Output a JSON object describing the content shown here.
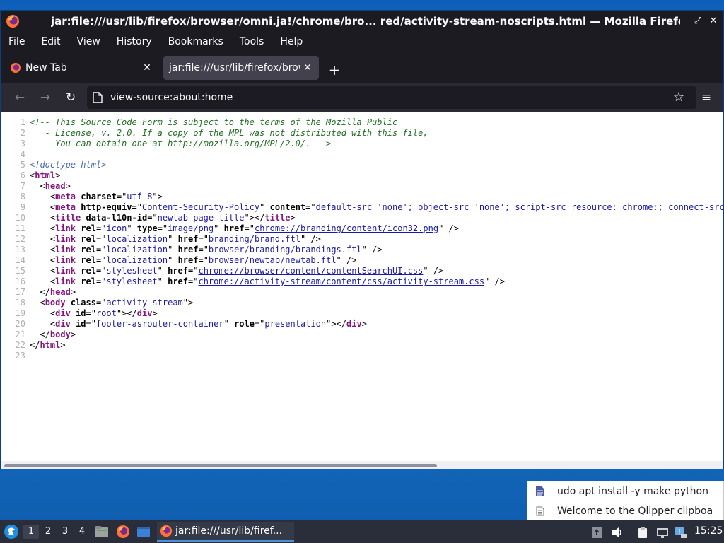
{
  "window": {
    "title": "jar:file:///usr/lib/firefox/browser/omni.ja!/chrome/bro... red/activity-stream-noscripts.html — Mozilla Firefox",
    "controls": [
      "–",
      "⤢",
      "✕"
    ]
  },
  "menu": [
    "File",
    "Edit",
    "View",
    "History",
    "Bookmarks",
    "Tools",
    "Help"
  ],
  "tabs": [
    {
      "label": "New Tab",
      "close": "✕"
    },
    {
      "label": "jar:file:///usr/lib/firefox/browser/omni.ja",
      "close": "✕"
    }
  ],
  "new_tab_symbol": "+",
  "nav": {
    "back": "←",
    "forward": "→",
    "reload": "↻",
    "url": "view-source:about:home",
    "star": "☆",
    "menu": "≡"
  },
  "source_lines": [
    [
      {
        "t": "<!-- This Source Code Form is subject to the terms of the Mozilla Public",
        "c": "c"
      }
    ],
    [
      {
        "t": "   - License, v. 2.0. If a copy of the MPL was not distributed with this file,",
        "c": "c"
      }
    ],
    [
      {
        "t": "   - You can obtain one at http://mozilla.org/MPL/2.0/. -->",
        "c": "c"
      }
    ],
    [],
    [
      {
        "t": "<!doctype html>",
        "c": "dt"
      }
    ],
    [
      {
        "t": "<",
        "c": ""
      },
      {
        "t": "html",
        "c": "tg"
      },
      {
        "t": ">",
        "c": ""
      }
    ],
    [
      {
        "t": "  <",
        "c": ""
      },
      {
        "t": "head",
        "c": "tg"
      },
      {
        "t": ">",
        "c": ""
      }
    ],
    [
      {
        "t": "    <",
        "c": ""
      },
      {
        "t": "meta",
        "c": "tg"
      },
      {
        "t": " ",
        "c": ""
      },
      {
        "t": "charset",
        "c": "at"
      },
      {
        "t": "=\"",
        "c": ""
      },
      {
        "t": "utf-8",
        "c": "av"
      },
      {
        "t": "\">",
        "c": ""
      }
    ],
    [
      {
        "t": "    <",
        "c": ""
      },
      {
        "t": "meta",
        "c": "tg"
      },
      {
        "t": " ",
        "c": ""
      },
      {
        "t": "http-equiv",
        "c": "at"
      },
      {
        "t": "=\"",
        "c": ""
      },
      {
        "t": "Content-Security-Policy",
        "c": "av"
      },
      {
        "t": "\" ",
        "c": ""
      },
      {
        "t": "content",
        "c": "at"
      },
      {
        "t": "=\"",
        "c": ""
      },
      {
        "t": "default-src 'none'; object-src 'none'; script-src resource: chrome:; connect-src",
        "c": "av"
      }
    ],
    [
      {
        "t": "    <",
        "c": ""
      },
      {
        "t": "title",
        "c": "tg"
      },
      {
        "t": " ",
        "c": ""
      },
      {
        "t": "data-l10n-id",
        "c": "at"
      },
      {
        "t": "=\"",
        "c": ""
      },
      {
        "t": "newtab-page-title",
        "c": "av"
      },
      {
        "t": "\"></",
        "c": ""
      },
      {
        "t": "title",
        "c": "tg"
      },
      {
        "t": ">",
        "c": ""
      }
    ],
    [
      {
        "t": "    <",
        "c": ""
      },
      {
        "t": "link",
        "c": "tg"
      },
      {
        "t": " ",
        "c": ""
      },
      {
        "t": "rel",
        "c": "at"
      },
      {
        "t": "=\"",
        "c": ""
      },
      {
        "t": "icon",
        "c": "av"
      },
      {
        "t": "\" ",
        "c": ""
      },
      {
        "t": "type",
        "c": "at"
      },
      {
        "t": "=\"",
        "c": ""
      },
      {
        "t": "image/png",
        "c": "av"
      },
      {
        "t": "\" ",
        "c": ""
      },
      {
        "t": "href",
        "c": "at"
      },
      {
        "t": "=\"",
        "c": ""
      },
      {
        "t": "chrome://branding/content/icon32.png",
        "c": "lk"
      },
      {
        "t": "\" />",
        "c": ""
      }
    ],
    [
      {
        "t": "    <",
        "c": ""
      },
      {
        "t": "link",
        "c": "tg"
      },
      {
        "t": " ",
        "c": ""
      },
      {
        "t": "rel",
        "c": "at"
      },
      {
        "t": "=\"",
        "c": ""
      },
      {
        "t": "localization",
        "c": "av"
      },
      {
        "t": "\" ",
        "c": ""
      },
      {
        "t": "href",
        "c": "at"
      },
      {
        "t": "=\"",
        "c": ""
      },
      {
        "t": "branding/brand.ftl",
        "c": "av"
      },
      {
        "t": "\" />",
        "c": ""
      }
    ],
    [
      {
        "t": "    <",
        "c": ""
      },
      {
        "t": "link",
        "c": "tg"
      },
      {
        "t": " ",
        "c": ""
      },
      {
        "t": "rel",
        "c": "at"
      },
      {
        "t": "=\"",
        "c": ""
      },
      {
        "t": "localization",
        "c": "av"
      },
      {
        "t": "\" ",
        "c": ""
      },
      {
        "t": "href",
        "c": "at"
      },
      {
        "t": "=\"",
        "c": ""
      },
      {
        "t": "browser/branding/brandings.ftl",
        "c": "av"
      },
      {
        "t": "\" />",
        "c": ""
      }
    ],
    [
      {
        "t": "    <",
        "c": ""
      },
      {
        "t": "link",
        "c": "tg"
      },
      {
        "t": " ",
        "c": ""
      },
      {
        "t": "rel",
        "c": "at"
      },
      {
        "t": "=\"",
        "c": ""
      },
      {
        "t": "localization",
        "c": "av"
      },
      {
        "t": "\" ",
        "c": ""
      },
      {
        "t": "href",
        "c": "at"
      },
      {
        "t": "=\"",
        "c": ""
      },
      {
        "t": "browser/newtab/newtab.ftl",
        "c": "av"
      },
      {
        "t": "\" />",
        "c": ""
      }
    ],
    [
      {
        "t": "    <",
        "c": ""
      },
      {
        "t": "link",
        "c": "tg"
      },
      {
        "t": " ",
        "c": ""
      },
      {
        "t": "rel",
        "c": "at"
      },
      {
        "t": "=\"",
        "c": ""
      },
      {
        "t": "stylesheet",
        "c": "av"
      },
      {
        "t": "\" ",
        "c": ""
      },
      {
        "t": "href",
        "c": "at"
      },
      {
        "t": "=\"",
        "c": ""
      },
      {
        "t": "chrome://browser/content/contentSearchUI.css",
        "c": "lk"
      },
      {
        "t": "\" />",
        "c": ""
      }
    ],
    [
      {
        "t": "    <",
        "c": ""
      },
      {
        "t": "link",
        "c": "tg"
      },
      {
        "t": " ",
        "c": ""
      },
      {
        "t": "rel",
        "c": "at"
      },
      {
        "t": "=\"",
        "c": ""
      },
      {
        "t": "stylesheet",
        "c": "av"
      },
      {
        "t": "\" ",
        "c": ""
      },
      {
        "t": "href",
        "c": "at"
      },
      {
        "t": "=\"",
        "c": ""
      },
      {
        "t": "chrome://activity-stream/content/css/activity-stream.css",
        "c": "lk"
      },
      {
        "t": "\" />",
        "c": ""
      }
    ],
    [
      {
        "t": "  </",
        "c": ""
      },
      {
        "t": "head",
        "c": "tg"
      },
      {
        "t": ">",
        "c": ""
      }
    ],
    [
      {
        "t": "  <",
        "c": ""
      },
      {
        "t": "body",
        "c": "tg"
      },
      {
        "t": " ",
        "c": ""
      },
      {
        "t": "class",
        "c": "at"
      },
      {
        "t": "=\"",
        "c": ""
      },
      {
        "t": "activity-stream",
        "c": "av"
      },
      {
        "t": "\">",
        "c": ""
      }
    ],
    [
      {
        "t": "    <",
        "c": ""
      },
      {
        "t": "div",
        "c": "tg"
      },
      {
        "t": " ",
        "c": ""
      },
      {
        "t": "id",
        "c": "at"
      },
      {
        "t": "=\"",
        "c": ""
      },
      {
        "t": "root",
        "c": "av"
      },
      {
        "t": "\"></",
        "c": ""
      },
      {
        "t": "div",
        "c": "tg"
      },
      {
        "t": ">",
        "c": ""
      }
    ],
    [
      {
        "t": "    <",
        "c": ""
      },
      {
        "t": "div",
        "c": "tg"
      },
      {
        "t": " ",
        "c": ""
      },
      {
        "t": "id",
        "c": "at"
      },
      {
        "t": "=\"",
        "c": ""
      },
      {
        "t": "footer-asrouter-container",
        "c": "av"
      },
      {
        "t": "\" ",
        "c": ""
      },
      {
        "t": "role",
        "c": "at"
      },
      {
        "t": "=\"",
        "c": ""
      },
      {
        "t": "presentation",
        "c": "av"
      },
      {
        "t": "\"></",
        "c": ""
      },
      {
        "t": "div",
        "c": "tg"
      },
      {
        "t": ">",
        "c": ""
      }
    ],
    [
      {
        "t": "  </",
        "c": ""
      },
      {
        "t": "body",
        "c": "tg"
      },
      {
        "t": ">",
        "c": ""
      }
    ],
    [
      {
        "t": "</",
        "c": ""
      },
      {
        "t": "html",
        "c": "tg"
      },
      {
        "t": ">",
        "c": ""
      }
    ],
    []
  ],
  "clipboard": [
    "udo apt install -y make python",
    "Welcome to the Qlipper clipboa"
  ],
  "taskbar": {
    "workspaces": [
      "1",
      "2",
      "3",
      "4"
    ],
    "active_workspace": 0,
    "task_label": "jar:file:///usr/lib/firef...",
    "clock": "15:25"
  },
  "colors": {
    "accent": "#4a90d9",
    "firefox_chrome": "#1c1b22",
    "tag": "#881280",
    "attr_value": "#1a1aa6",
    "comment": "#236e25"
  }
}
